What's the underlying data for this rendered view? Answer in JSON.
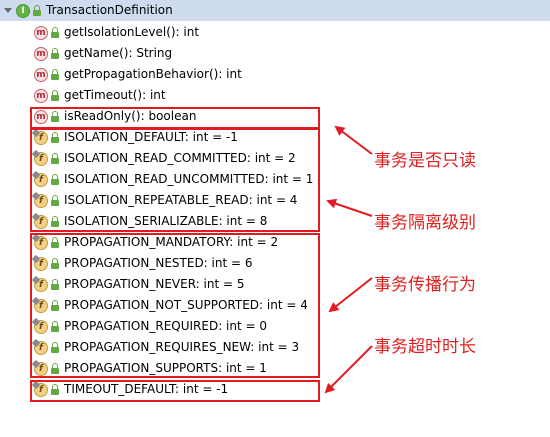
{
  "tree": {
    "root": {
      "label": "TransactionDefinition",
      "icon": "interface-icon"
    },
    "methods": [
      {
        "label": "getIsolationLevel(): int",
        "icon": "method-icon"
      },
      {
        "label": "getName(): String",
        "icon": "method-icon"
      },
      {
        "label": "getPropagationBehavior(): int",
        "icon": "method-icon"
      },
      {
        "label": "getTimeout(): int",
        "icon": "method-icon"
      },
      {
        "label": "isReadOnly(): boolean",
        "icon": "method-icon"
      }
    ],
    "fields": [
      {
        "label": "ISOLATION_DEFAULT: int = -1",
        "icon": "field-icon"
      },
      {
        "label": "ISOLATION_READ_COMMITTED: int = 2",
        "icon": "field-icon"
      },
      {
        "label": "ISOLATION_READ_UNCOMMITTED: int = 1",
        "icon": "field-icon"
      },
      {
        "label": "ISOLATION_REPEATABLE_READ: int = 4",
        "icon": "field-icon"
      },
      {
        "label": "ISOLATION_SERIALIZABLE: int = 8",
        "icon": "field-icon"
      },
      {
        "label": "PROPAGATION_MANDATORY: int = 2",
        "icon": "field-icon"
      },
      {
        "label": "PROPAGATION_NESTED: int = 6",
        "icon": "field-icon"
      },
      {
        "label": "PROPAGATION_NEVER: int = 5",
        "icon": "field-icon"
      },
      {
        "label": "PROPAGATION_NOT_SUPPORTED: int = 4",
        "icon": "field-icon"
      },
      {
        "label": "PROPAGATION_REQUIRED: int = 0",
        "icon": "field-icon"
      },
      {
        "label": "PROPAGATION_REQUIRES_NEW: int = 3",
        "icon": "field-icon"
      },
      {
        "label": "PROPAGATION_SUPPORTS: int = 1",
        "icon": "field-icon"
      },
      {
        "label": "TIMEOUT_DEFAULT: int = -1",
        "icon": "field-icon"
      }
    ]
  },
  "icon_letters": {
    "interface": "I",
    "method": "m",
    "field": "f"
  },
  "annotations": {
    "readonly": "事务是否只读",
    "isolation": "事务隔离级别",
    "propagation": "事务传播行为",
    "timeout": "事务超时时长"
  },
  "colors": {
    "selection": "#cfdcef",
    "highlight": "#e21b22",
    "annotation": "#e02020"
  }
}
